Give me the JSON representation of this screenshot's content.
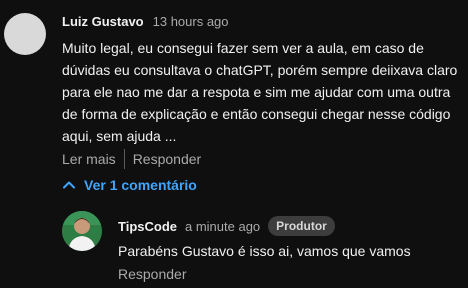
{
  "comment": {
    "author": "Luiz Gustavo",
    "time": "13 hours ago",
    "text": "Muito legal, eu consegui fazer sem ver a aula, em caso de dúvidas eu consultava o chatGPT, porém sempre deiixava claro para ele nao me dar a respota e sim me ajudar com uma outra de forma de explicação e então consegui chegar nesse código aqui, sem ajuda ...",
    "read_more": "Ler mais",
    "reply": "Responder"
  },
  "replies_toggle": {
    "label": "Ver 1 comentário",
    "icon": "chevron-up-icon",
    "color": "#3ea6ff"
  },
  "reply": {
    "author": "TipsCode",
    "time": "a minute ago",
    "badge": "Produtor",
    "text": "Parabéns Gustavo é isso ai, vamos que vamos",
    "reply": "Responder"
  }
}
